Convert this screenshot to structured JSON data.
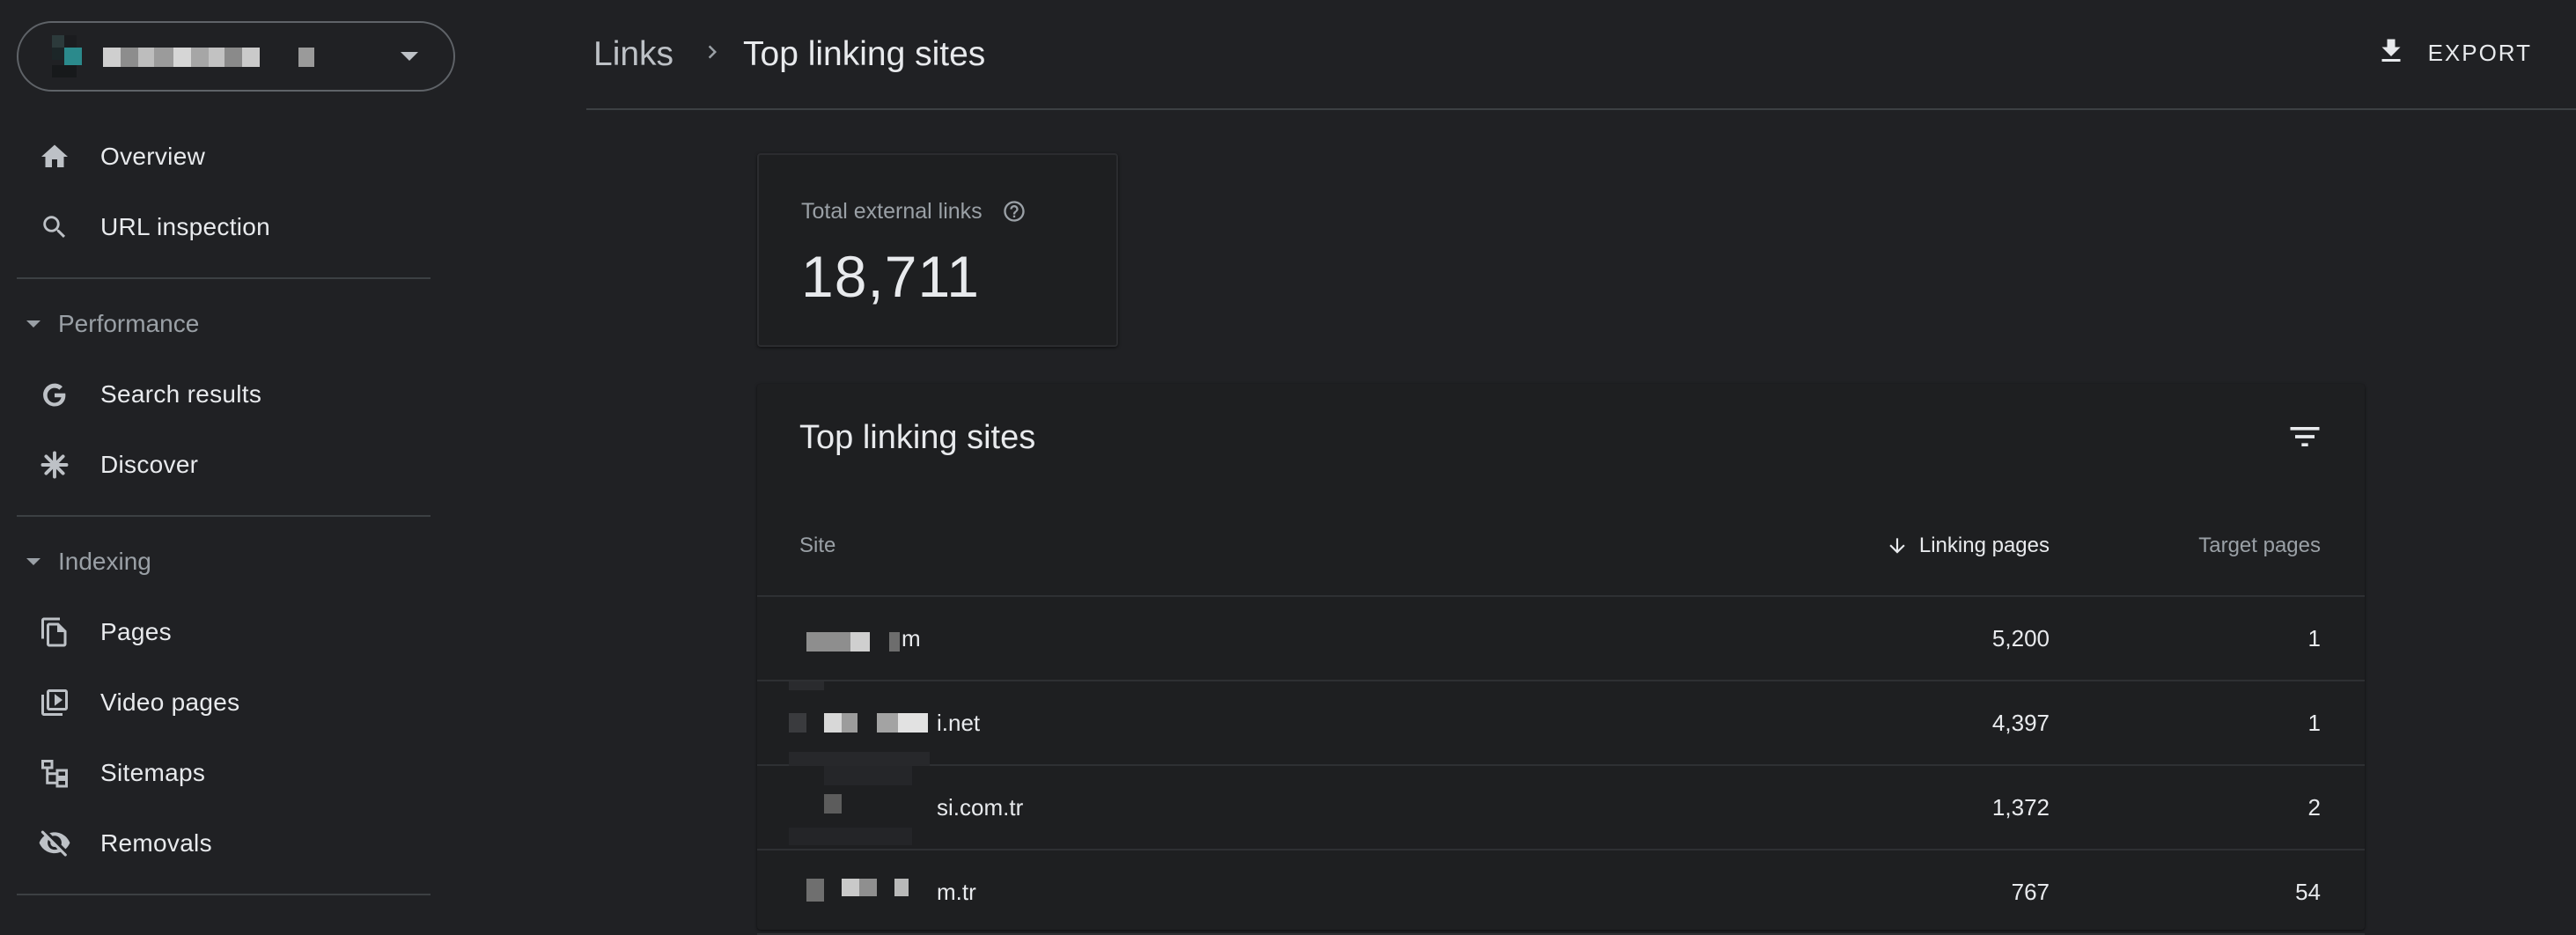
{
  "property": {
    "name": "▒▒▒▒▒▒▒▒ ▒"
  },
  "sidebar": {
    "items_top": [
      {
        "label": "Overview",
        "icon": "home-icon"
      },
      {
        "label": "URL inspection",
        "icon": "search-icon"
      }
    ],
    "performance": {
      "label": "Performance",
      "items": [
        {
          "label": "Search results",
          "icon": "google-icon"
        },
        {
          "label": "Discover",
          "icon": "asterisk-icon"
        }
      ]
    },
    "indexing": {
      "label": "Indexing",
      "items": [
        {
          "label": "Pages",
          "icon": "pages-icon"
        },
        {
          "label": "Video pages",
          "icon": "video-pages-icon"
        },
        {
          "label": "Sitemaps",
          "icon": "sitemaps-icon"
        },
        {
          "label": "Removals",
          "icon": "eye-off-icon"
        }
      ]
    }
  },
  "header": {
    "breadcrumb_root": "Links",
    "breadcrumb_current": "Top linking sites",
    "export_label": "EXPORT"
  },
  "summary": {
    "label": "Total external links",
    "value": "18,711"
  },
  "table": {
    "title": "Top linking sites",
    "columns": {
      "site": "Site",
      "linking_pages": "Linking pages",
      "target_pages": "Target pages"
    },
    "sort": "linking_pages-desc",
    "rows": [
      {
        "site": "m",
        "linking_pages": "5,200",
        "target_pages": "1"
      },
      {
        "site": "i.net",
        "linking_pages": "4,397",
        "target_pages": "1"
      },
      {
        "site": "si.com.tr",
        "linking_pages": "1,372",
        "target_pages": "2"
      },
      {
        "site": "m.tr",
        "linking_pages": "767",
        "target_pages": "54"
      }
    ]
  },
  "colors": {
    "background": "#202124",
    "card": "#1e1f21",
    "text": "#e8eaed",
    "muted": "#9aa0a6",
    "divider": "#3c4043"
  }
}
